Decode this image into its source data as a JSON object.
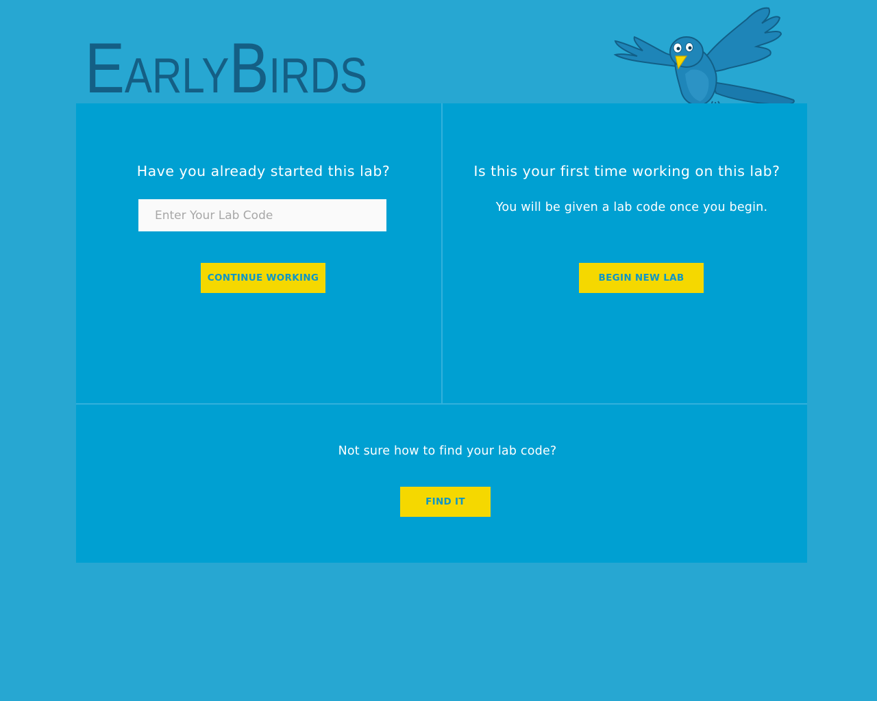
{
  "header": {
    "logo_text_first": "Early",
    "logo_text_second": "Birds",
    "mascot_icon": "bluebird-mascot-icon"
  },
  "continue_panel": {
    "title": "Have you already started this lab?",
    "lab_code_placeholder": "Enter Your Lab Code",
    "lab_code_value": "",
    "button_label": "CONTINUE WORKING"
  },
  "new_panel": {
    "title": "Is this your first time working on this lab?",
    "description": "You will be given a lab code once you begin.",
    "button_label": "BEGIN NEW LAB"
  },
  "help_panel": {
    "text": "Not sure how to find your lab code?",
    "button_label": "FIND IT"
  },
  "colors": {
    "page_background": "#27a7d2",
    "panel_background": "#00a0d2",
    "button_background": "#f5d800",
    "button_text": "#0e96c6",
    "logo": "#145f85"
  }
}
